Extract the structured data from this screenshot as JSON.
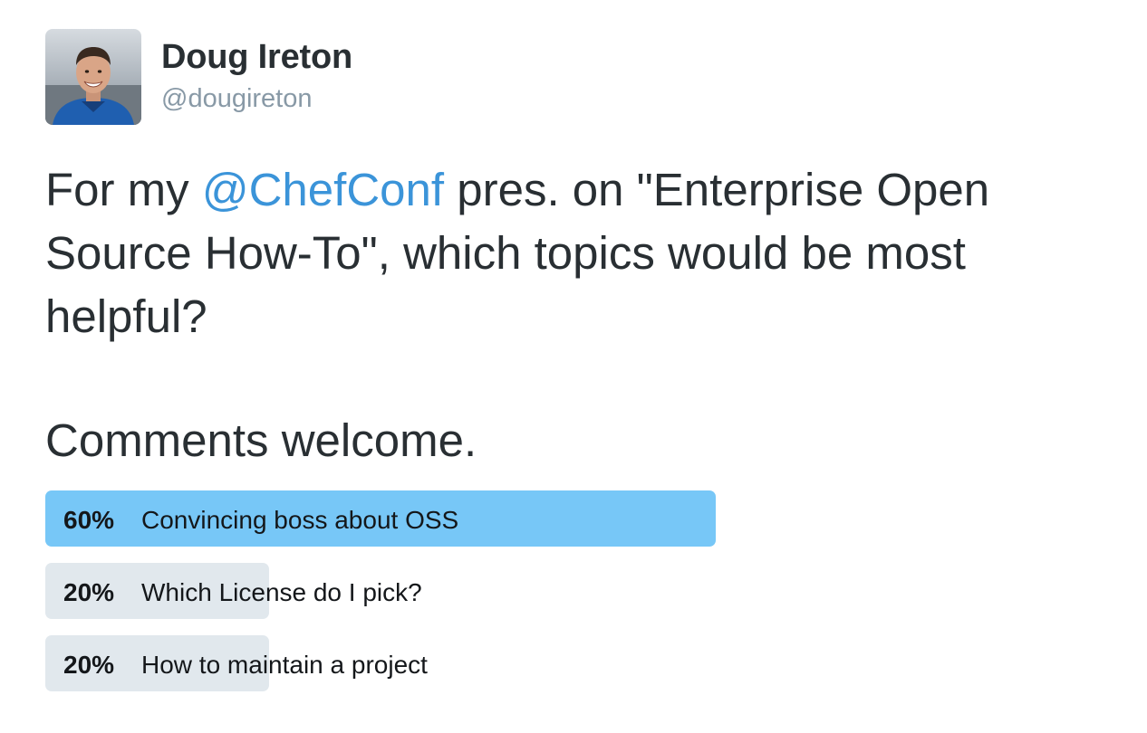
{
  "author": {
    "display_name": "Doug Ireton",
    "handle": "@dougireton",
    "avatar_icon": "user-avatar-photo"
  },
  "tweet": {
    "text_before_mention": "For my ",
    "mention": "@ChefConf",
    "text_line1_after_mention": " pres. on \"Enterprise Open",
    "text_line2": "Source How-To\", which topics would be most",
    "text_line3": "helpful?",
    "comments": "Comments welcome."
  },
  "poll": {
    "options": [
      {
        "percent_label": "60%",
        "percent": 60,
        "label": "Convincing boss about OSS",
        "winner": true
      },
      {
        "percent_label": "20%",
        "percent": 20,
        "label": "Which License do I pick?",
        "winner": false
      },
      {
        "percent_label": "20%",
        "percent": 20,
        "label": "How to maintain a project",
        "winner": false
      }
    ]
  },
  "colors": {
    "text": "#292f33",
    "handle": "#8899a6",
    "mention": "#3b94d9",
    "poll_winner": "#77c7f7",
    "poll_other": "#e1e8ed"
  }
}
